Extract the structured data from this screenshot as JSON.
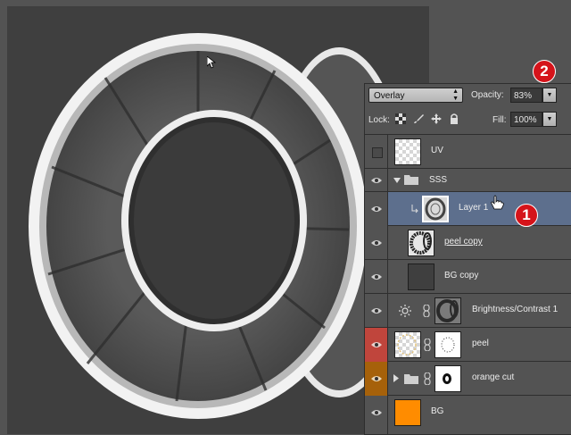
{
  "blend_mode": "Overlay",
  "opacity": {
    "label": "Opacity:",
    "value": "83%"
  },
  "lock": {
    "label": "Lock:"
  },
  "fill": {
    "label": "Fill:",
    "value": "100%"
  },
  "layers": [
    {
      "name": "UV"
    },
    {
      "name": "SSS"
    },
    {
      "name": "Layer 1"
    },
    {
      "name": "peel copy"
    },
    {
      "name": "BG copy"
    },
    {
      "name": "Brightness/Contrast 1"
    },
    {
      "name": "peel"
    },
    {
      "name": "orange cut"
    },
    {
      "name": "BG"
    }
  ],
  "badges": {
    "one": "1",
    "two": "2"
  },
  "colors": {
    "peel_eye": "#c0453c",
    "orange_cut_eye": "#a6610a",
    "bg_thumb": "#ff8c00",
    "selected_row": "#5d6f8d",
    "badge": "#d5131a"
  }
}
